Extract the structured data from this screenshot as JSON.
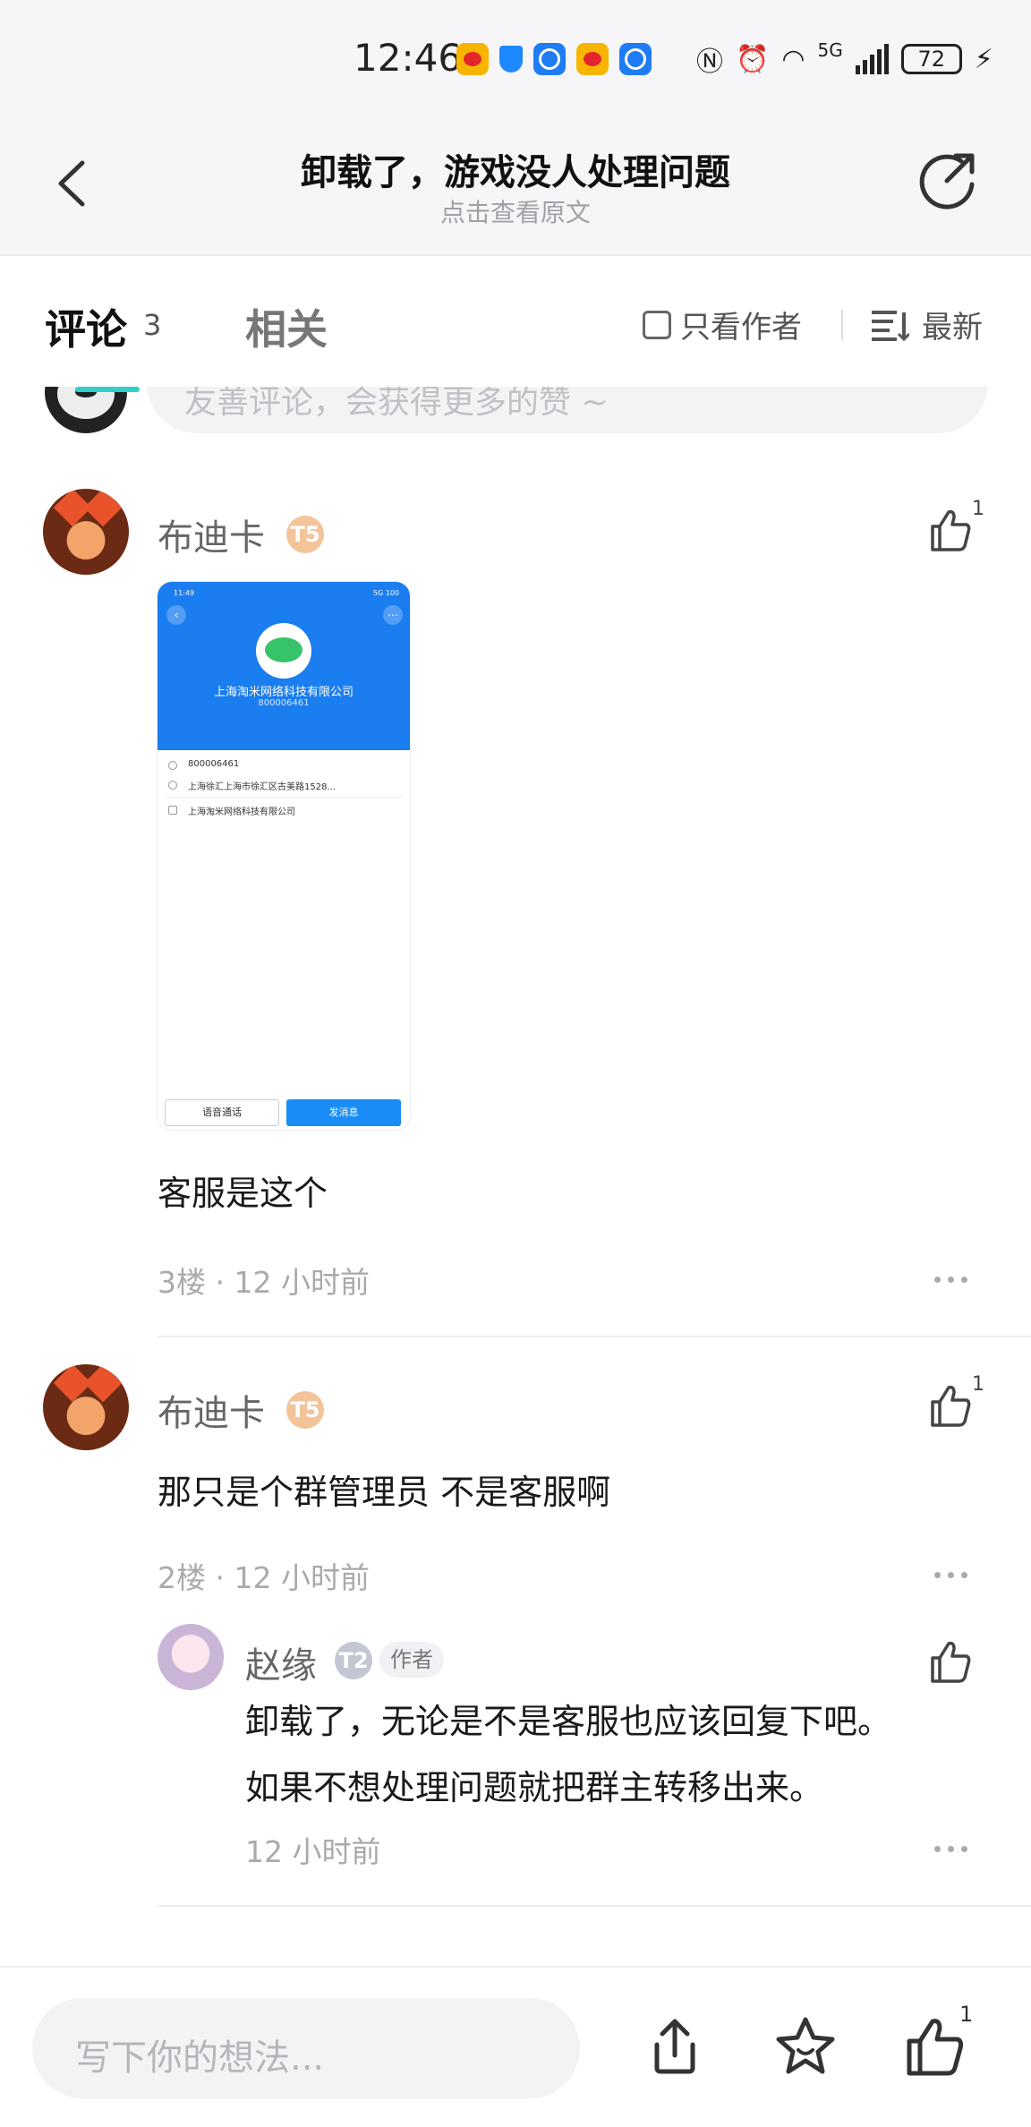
{
  "status_bar": {
    "time": "12:46",
    "network": "5G",
    "battery": "72"
  },
  "header": {
    "title": "卸载了，游戏没人处理问题",
    "subtitle": "点击查看原文"
  },
  "tabs": {
    "comments_label": "评论",
    "comments_count": "3",
    "related_label": "相关",
    "author_only_label": "只看作者",
    "sort_label": "最新"
  },
  "composer": {
    "placeholder": "友善评论，会获得更多的赞 ~"
  },
  "comments": [
    {
      "username": "布迪卡",
      "level": "T5",
      "likes": "1",
      "text": "客服是这个",
      "floor_time": "3楼 · 12 小时前",
      "attachment": {
        "status_time": "11:49",
        "status_right": "5G 100",
        "company": "上海淘米网络科技有限公司",
        "id": "800006461",
        "info_id": "800006461",
        "info_address": "上海徐汇上海市徐汇区古美路1528...",
        "info_company": "上海淘米网络科技有限公司",
        "btn_call": "语音通话",
        "btn_message": "发消息"
      }
    },
    {
      "username": "布迪卡",
      "level": "T5",
      "likes": "1",
      "text": "那只是个群管理员 不是客服啊",
      "floor_time": "2楼 · 12 小时前",
      "reply": {
        "username": "赵缘",
        "level": "T2",
        "author_tag": "作者",
        "text_line1": "卸载了，无论是不是客服也应该回复下吧。",
        "text_line2": "如果不想处理问题就把群主转移出来。",
        "time": "12 小时前"
      }
    }
  ],
  "bottom_bar": {
    "input_placeholder": "写下你的想法...",
    "like_count": "1"
  },
  "colors": {
    "accent_teal": "#2fd0c8",
    "qq_blue": "#1a7df0",
    "text_gray": "#aaaaaa"
  }
}
